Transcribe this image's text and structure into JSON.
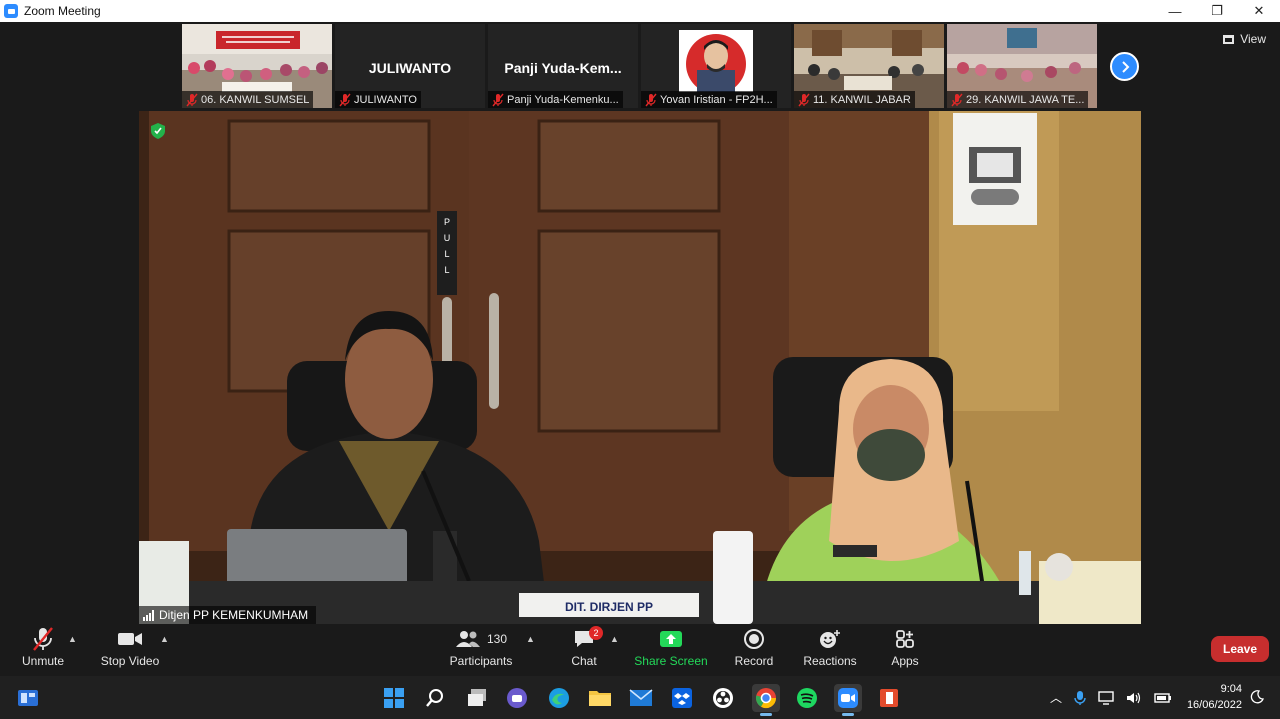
{
  "window": {
    "title": "Zoom Meeting",
    "controls": {
      "minimize": "—",
      "restore": "❐",
      "close": "✕"
    }
  },
  "view_button": {
    "label": "View"
  },
  "thumbnails": [
    {
      "name": "06. KANWIL SUMSEL",
      "kind": "room",
      "wall": "#d9d4cc",
      "banner": true
    },
    {
      "name": "JULIWANTO",
      "kind": "name",
      "display": "JULIWANTO"
    },
    {
      "name": "Panji Yuda-Kemenku...",
      "kind": "name",
      "display": "Panji  Yuda-Kem..."
    },
    {
      "name": "Yovan Iristian - FP2H...",
      "kind": "avatar"
    },
    {
      "name": "11. KANWIL JABAR",
      "kind": "room",
      "wall": "#cdbfa9",
      "banner": false
    },
    {
      "name": "29. KANWIL JAWA TE...",
      "kind": "room",
      "wall": "#d8c9c0",
      "banner": false
    }
  ],
  "main_video": {
    "speaker_name": "Ditjen PP KEMENKUMHAM",
    "door_sign": "PULL",
    "desk_sign": "DIT. DIRJEN PP"
  },
  "toolbar": {
    "unmute": "Unmute",
    "stop_video": "Stop Video",
    "participants": "Participants",
    "participants_count": "130",
    "chat": "Chat",
    "chat_badge": "2",
    "share_screen": "Share Screen",
    "record": "Record",
    "reactions": "Reactions",
    "apps": "Apps",
    "leave": "Leave"
  },
  "taskbar": {
    "time": "9:04",
    "date": "16/06/2022",
    "icons": [
      "widgets-icon",
      "windows-start-icon",
      "search-icon",
      "task-view-icon",
      "teams-chat-icon",
      "edge-icon",
      "file-explorer-icon",
      "mail-icon",
      "dropbox-icon",
      "obs-icon",
      "chrome-icon",
      "spotify-icon",
      "zoom-icon",
      "office-icon"
    ]
  },
  "colors": {
    "accent": "#2d8cff",
    "leave": "#c72e2e",
    "share_green": "#23d959",
    "mute_red": "#e02828"
  }
}
